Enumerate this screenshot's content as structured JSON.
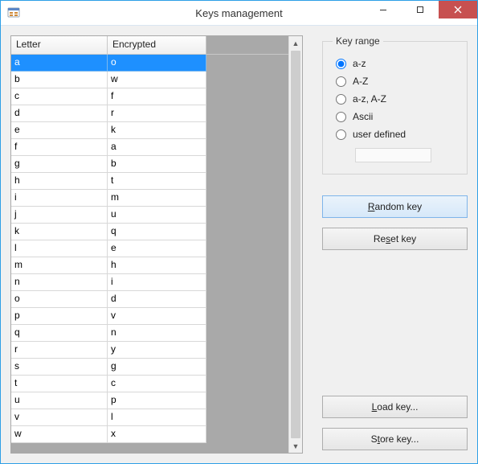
{
  "window": {
    "title": "Keys management"
  },
  "grid": {
    "columns": {
      "letter": "Letter",
      "encrypted": "Encrypted"
    },
    "rows": [
      {
        "letter": "a",
        "encrypted": "o",
        "selected": true
      },
      {
        "letter": "b",
        "encrypted": "w"
      },
      {
        "letter": "c",
        "encrypted": "f"
      },
      {
        "letter": "d",
        "encrypted": "r"
      },
      {
        "letter": "e",
        "encrypted": "k"
      },
      {
        "letter": "f",
        "encrypted": "a"
      },
      {
        "letter": "g",
        "encrypted": "b"
      },
      {
        "letter": "h",
        "encrypted": "t"
      },
      {
        "letter": "i",
        "encrypted": "m"
      },
      {
        "letter": "j",
        "encrypted": "u"
      },
      {
        "letter": "k",
        "encrypted": "q"
      },
      {
        "letter": "l",
        "encrypted": "e"
      },
      {
        "letter": "m",
        "encrypted": "h"
      },
      {
        "letter": "n",
        "encrypted": "i"
      },
      {
        "letter": "o",
        "encrypted": "d"
      },
      {
        "letter": "p",
        "encrypted": "v"
      },
      {
        "letter": "q",
        "encrypted": "n"
      },
      {
        "letter": "r",
        "encrypted": "y"
      },
      {
        "letter": "s",
        "encrypted": "g"
      },
      {
        "letter": "t",
        "encrypted": "c"
      },
      {
        "letter": "u",
        "encrypted": "p"
      },
      {
        "letter": "v",
        "encrypted": "l"
      },
      {
        "letter": "w",
        "encrypted": "x"
      }
    ]
  },
  "key_range": {
    "legend": "Key range",
    "options": {
      "az": "a-z",
      "AZ": "A-Z",
      "azAZ": "a-z, A-Z",
      "ascii": "Ascii",
      "user_defined": "user defined"
    },
    "selected": "az",
    "user_defined_value": ""
  },
  "buttons": {
    "random": {
      "pre": "",
      "ul": "R",
      "post": "andom key"
    },
    "reset": {
      "pre": "Re",
      "ul": "s",
      "post": "et key"
    },
    "load": {
      "pre": "",
      "ul": "L",
      "post": "oad key..."
    },
    "store": {
      "pre": "S",
      "ul": "t",
      "post": "ore key..."
    }
  }
}
